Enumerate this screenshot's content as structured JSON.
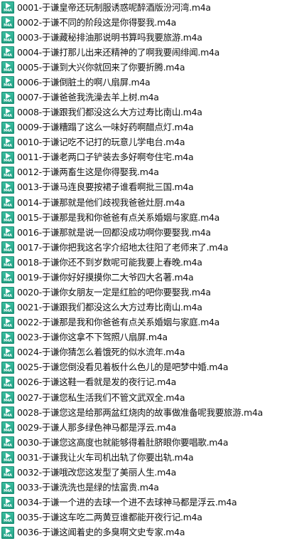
{
  "file_list": {
    "icon": "m4a-audio-file-icon",
    "icon_badge": "M4A",
    "icon_color": "#2aae92",
    "items": [
      {
        "name": "0001-于谦皇帝还玩制服诱惑呢醉酒版汾河湾.m4a"
      },
      {
        "name": "0002-于谦不同的阶段这是你得娶我.m4a"
      },
      {
        "name": "0003-于谦藏秘排油那说明书算吗我要旅游.m4a"
      },
      {
        "name": "0004-于谦打那儿出来还精神的了啊我要闹绯闻.m4a"
      },
      {
        "name": "0005-于谦到大兴你就回来了你要折腾.m4a"
      },
      {
        "name": "0006-于谦倒脏土的啊八扇屏.m4a"
      },
      {
        "name": "0007-于谦爸爸我洗澡去羊上树.m4a"
      },
      {
        "name": "0008-于谦跟我们都没这么大方过寿比南山.m4a"
      },
      {
        "name": "0009-于谦糟蹋了这么一味好药啊醋点灯.m4a"
      },
      {
        "name": "0010-于谦记吃不记打的玩意儿学电台.m4a"
      },
      {
        "name": "0011-于谦老两口子铲装去多好啊夸住宅.m4a"
      },
      {
        "name": "0012-于谦两畜生这是你得娶我.m4a"
      },
      {
        "name": "0013-于谦马连良要按裙子谁看啊批三国.m4a"
      },
      {
        "name": "0014-于谦那就是他们歧视我爸爸灶厨.m4a"
      },
      {
        "name": "0015-于谦那是我和你爸爸有点关系婚姻与家庭.m4a"
      },
      {
        "name": "0016-于谦那就是说一回都没成功啊你要娶我.m4a"
      },
      {
        "name": "0017-于谦你把我这名字介绍地太往阳了老师来了.m4a"
      },
      {
        "name": "0018-于谦你还不到岁数呢可能我要上春晚.m4a"
      },
      {
        "name": "0019-于谦你好好摸摸你二大爷四大名著.m4a"
      },
      {
        "name": "0020-于谦你女朋友一定是红脸的吧你要娶我.m4a"
      },
      {
        "name": "0021-于谦跟我们都没这么大方过寿比南山.m4a"
      },
      {
        "name": "0022-于谦那是我和你爸爸有点关系婚姻与家庭.m4a"
      },
      {
        "name": "0023-于谦你这拿不下驾照八扇屏.m4a"
      },
      {
        "name": "0024-于谦你猜怎么着饿死的似水流年.m4a"
      },
      {
        "name": "0025-于谦您倒没看见着板什么色儿的是吧梦中婚.m4a"
      },
      {
        "name": "0026-于谦这鞋一看就是发的夜行记.m4a"
      },
      {
        "name": "0027-于谦您私生活我们不管文武双全.m4a"
      },
      {
        "name": "0028-于谦您这是给那两盆红烧肉的故事做准备呢我要旅游.m4a"
      },
      {
        "name": "0029-于谦人那多绿色神马都是浮云.m4a"
      },
      {
        "name": "0030-于谦您这高度也就能够得着肚脐眼你要唱歌.m4a"
      },
      {
        "name": "0031-于谦我让火车司机出轨了你要出轨.m4a"
      },
      {
        "name": "0032-于谦哦改您这发型了美丽人生.m4a"
      },
      {
        "name": "0033-于谦洗洗也是绿的怯富贵.m4a"
      },
      {
        "name": "0034-于谦一个进的去球一个进不去球神马都是浮云.m4a"
      },
      {
        "name": "0035-于谦这车吃二两黄豆谁都能开夜行记.m4a"
      },
      {
        "name": "0036-于谦这闻着史的多臭啊文史专家.m4a"
      }
    ]
  }
}
